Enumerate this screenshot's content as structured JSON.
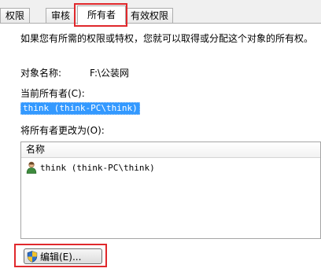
{
  "tabs": [
    {
      "label": "权限",
      "active": false
    },
    {
      "label": "审核",
      "active": false
    },
    {
      "label": "所有者",
      "active": true
    },
    {
      "label": "有效权限",
      "active": false
    }
  ],
  "description": "如果您有所需的权限或特权，您就可以取得或分配这个对象的所有权。",
  "object": {
    "label": "对象名称:",
    "value": "F:\\公装网"
  },
  "current_owner": {
    "label": "当前所有者(C):",
    "value": "think (think-PC\\think)"
  },
  "change_owner": {
    "label": "将所有者更改为(O):",
    "column_header": "名称",
    "items": [
      {
        "name": "think (think-PC\\think)",
        "icon": "user-icon"
      }
    ]
  },
  "edit_button": {
    "label": "编辑(E)...",
    "icon": "uac-shield-icon"
  },
  "colors": {
    "highlight": "#e0282c",
    "selection": "#3399ff"
  }
}
